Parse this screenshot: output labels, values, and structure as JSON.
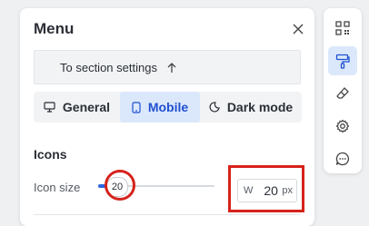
{
  "panel": {
    "title": "Menu",
    "section_link": "To section settings"
  },
  "tabs": [
    {
      "label": "General",
      "icon": "desktop-icon",
      "active": false
    },
    {
      "label": "Mobile",
      "icon": "mobile-icon",
      "active": true
    },
    {
      "label": "Dark mode",
      "icon": "moon-icon",
      "active": false
    }
  ],
  "icons_section": {
    "heading": "Icons",
    "icon_size_label": "Icon size",
    "slider_value": "20",
    "slider_fraction": 0.1,
    "width_prefix": "W",
    "width_value": "20",
    "width_unit": "px"
  },
  "toolbar": {
    "items": [
      "qr-code-icon",
      "paint-roller-icon",
      "eraser-icon",
      "settings-gear-icon",
      "chat-bubble-icon"
    ],
    "active": "paint-roller-icon"
  },
  "colors": {
    "accent": "#2b66e0",
    "active_tab_bg": "#dbe8fb",
    "annotation": "#d6231c"
  }
}
